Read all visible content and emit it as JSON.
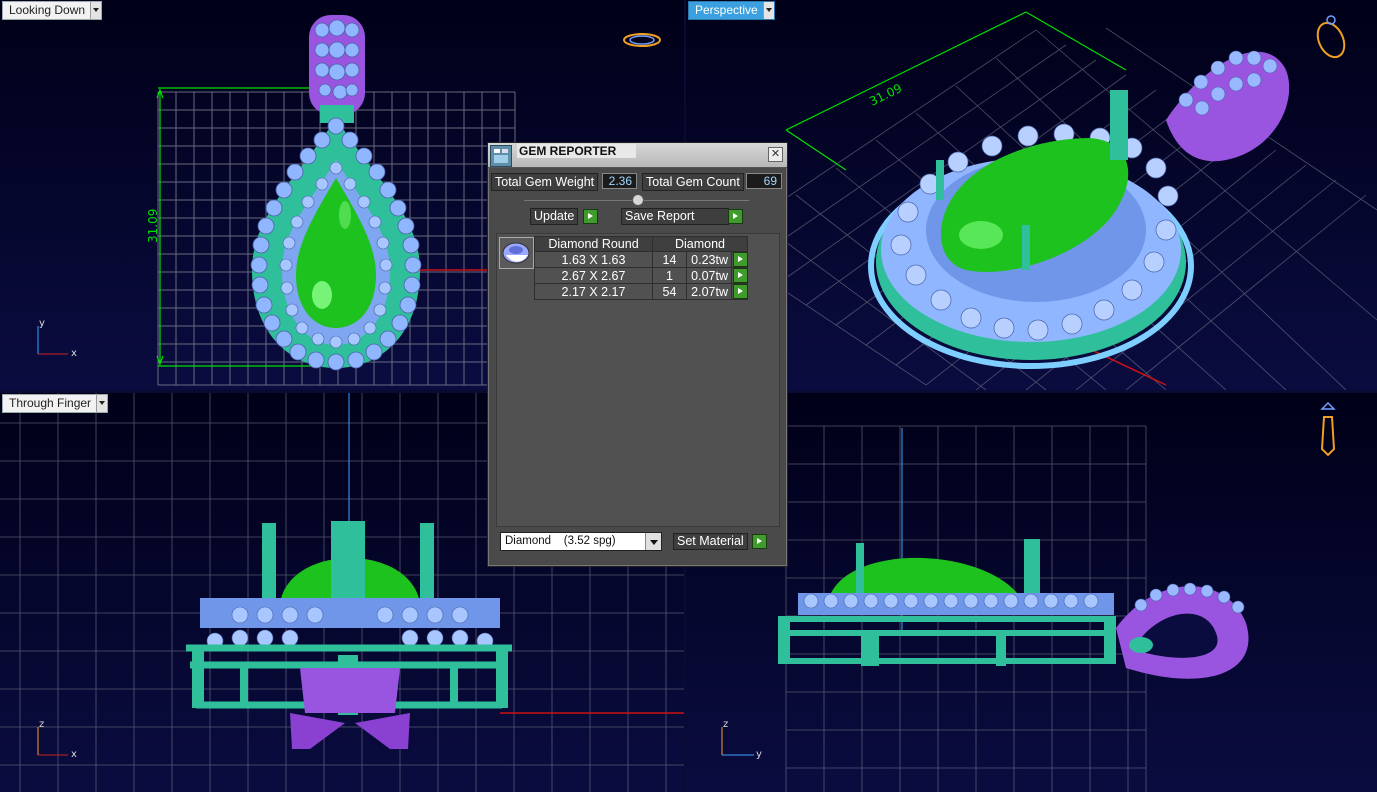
{
  "viewports": {
    "top_left": {
      "label": "Looking Down",
      "axes": [
        "y",
        "x"
      ],
      "dimension": "31.09"
    },
    "top_right": {
      "label": "Perspective",
      "dimension": "31.09"
    },
    "bottom_left": {
      "label": "Through Finger",
      "axes": [
        "z",
        "x"
      ]
    },
    "bottom_right": {
      "label": "",
      "axes": [
        "z",
        "y"
      ]
    }
  },
  "gem_reporter": {
    "title": "GEM REPORTER",
    "close_label": "✕",
    "total_gem_weight_label": "Total Gem Weight",
    "total_gem_weight": "2.36",
    "total_gem_count_label": "Total Gem Count",
    "total_gem_count": "69",
    "update_label": "Update",
    "save_report_label": "Save Report",
    "table": {
      "headers": [
        "Diamond Round",
        "Diamond"
      ],
      "rows": [
        {
          "size": "1.63 X 1.63",
          "count": "14",
          "weight": "0.23tw"
        },
        {
          "size": "2.67 X 2.67",
          "count": "1",
          "weight": "0.07tw"
        },
        {
          "size": "2.17 X 2.17",
          "count": "54",
          "weight": "2.07tw"
        }
      ]
    },
    "material_select": "Diamond    (3.52 spg)",
    "set_material_label": "Set Material"
  },
  "colors": {
    "metal_teal": "#2fbf9b",
    "gem_green": "#22cc22",
    "diamond_blue": "#8fb6ff",
    "bail_purple": "#9a55e0",
    "grid_line": "#8a8a99",
    "dimension_green": "#00e000"
  }
}
